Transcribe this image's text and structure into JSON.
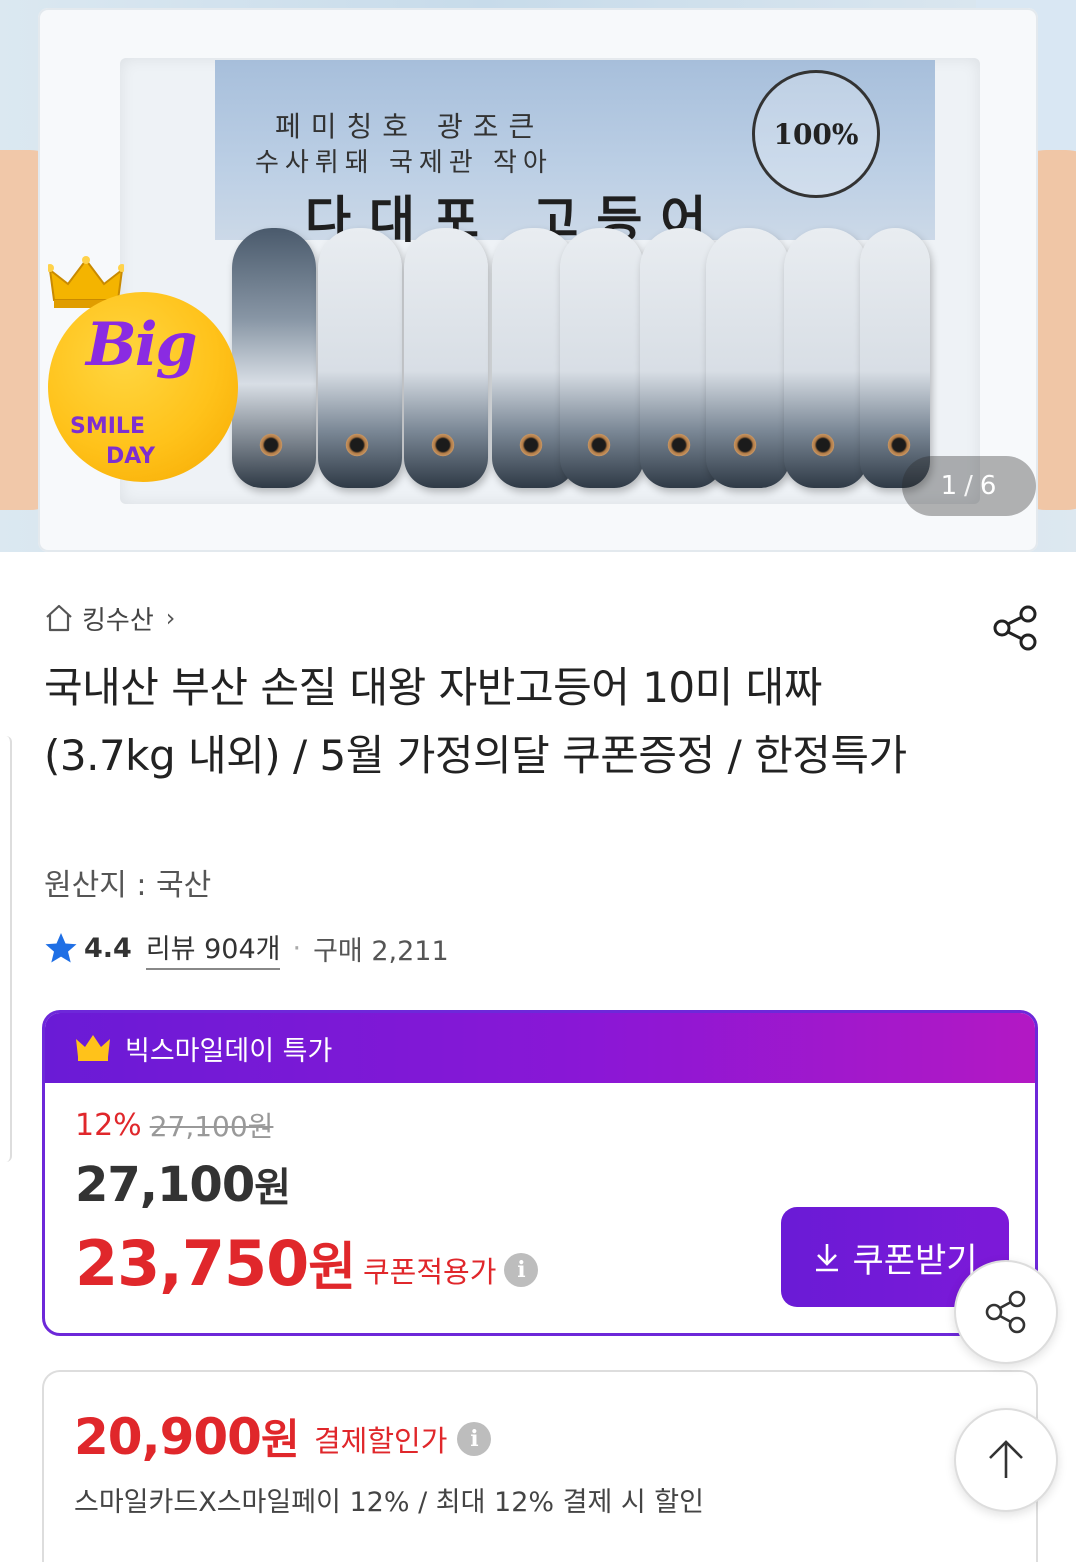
{
  "hero": {
    "label_line1": "페미칭호 광조큰",
    "label_line2": "수사뤼돼 국제관 작아",
    "label_main": "다대포 고등어",
    "seal_text": "100%",
    "badge_big": "Big",
    "badge_smile": "SMILE",
    "badge_day": "DAY",
    "image_index": "1",
    "image_separator": "/",
    "image_total": "6"
  },
  "seller": {
    "name": "킹수산",
    "chevron": "›",
    "home_icon": "home-icon"
  },
  "product": {
    "title": "국내산 부산 손질 대왕 자반고등어 10미 대짜 (3.7kg 내외) / 5월 가정의달 쿠폰증정 / 한정특가",
    "origin": "원산지 : 국산",
    "rating": "4.4",
    "reviews": "리뷰 904개",
    "separator": "·",
    "purchases": "구매 2,211"
  },
  "promo": {
    "header": "빅스마일데이 특가",
    "discount_pct": "12%",
    "original_price": "27,100원",
    "price_number": "27,100",
    "price_unit": "원",
    "coupon_price_number": "23,750",
    "coupon_price_unit": "원",
    "coupon_label": "쿠폰적용가",
    "coupon_button": "쿠폰받기",
    "accent_color": "#6a1bd6"
  },
  "payment": {
    "price_number": "20,900",
    "price_unit": "원",
    "label": "결제할인가",
    "description": "스마일카드X스마일페이 12% / 최대 12% 결제 시 할인"
  },
  "colors": {
    "sale_red": "#e0272b",
    "purple": "#6d28d9",
    "star_blue": "#1f6fe5"
  },
  "icons": {
    "info": "i"
  }
}
